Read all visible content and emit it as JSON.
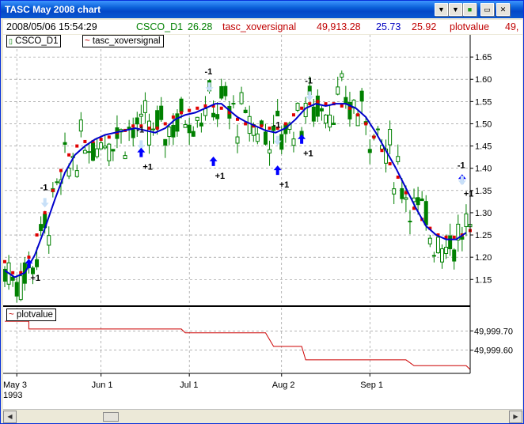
{
  "window": {
    "title": "TASC May 2008 chart"
  },
  "title_buttons": [
    "▼",
    "▼",
    "■",
    "▭",
    "✕"
  ],
  "info": {
    "datetime": "2008/05/06 15:54:29",
    "symbol": "CSCO_D1",
    "symbol_value": "26.28",
    "indicator": "tasc_xoversignal",
    "ind_v1": "49,913.28",
    "ind_v2": "25.73",
    "ind_v3": "25.92",
    "plot_name": "plotvalue",
    "plot_trunc": "49,"
  },
  "legend": {
    "symbol": "CSCO_D1",
    "indicator": "tasc_xoversignal",
    "sub": "plotvalue"
  },
  "colors": {
    "up": "#008000",
    "down": "#008000",
    "blue_line": "#0000cc",
    "red_dots": "#e00000",
    "sub_line": "#cc0000",
    "signal_arrow": "#0000ff",
    "signal_ghost": "#c8e0f8"
  },
  "x_axis": {
    "labels": [
      "May 3",
      "Jun 1",
      "Jul 1",
      "Aug 2",
      "Sep 1"
    ],
    "year": "1993"
  },
  "chart_data": [
    {
      "type": "candlestick",
      "series": [
        {
          "name": "CSCO_D1"
        },
        {
          "name": "tasc_xoversignal"
        }
      ],
      "ylim": [
        1.09,
        1.7
      ],
      "y_ticks": [
        "1.65",
        "1.60",
        "1.55",
        "1.50",
        "1.45",
        "1.40",
        "1.35",
        "1.30",
        "1.25",
        "1.20",
        "1.15"
      ],
      "y_tick_values": [
        1.65,
        1.6,
        1.55,
        1.5,
        1.45,
        1.4,
        1.35,
        1.3,
        1.25,
        1.2,
        1.15
      ],
      "grid": true,
      "blue_line": [
        [
          0,
          1.17
        ],
        [
          5,
          1.155
        ],
        [
          10,
          1.165
        ],
        [
          15,
          1.205
        ],
        [
          20,
          1.265
        ],
        [
          25,
          1.33
        ],
        [
          30,
          1.39
        ],
        [
          35,
          1.43
        ],
        [
          40,
          1.45
        ],
        [
          45,
          1.465
        ],
        [
          50,
          1.475
        ],
        [
          55,
          1.48
        ],
        [
          60,
          1.485
        ],
        [
          65,
          1.49
        ],
        [
          70,
          1.485
        ],
        [
          75,
          1.48
        ],
        [
          80,
          1.49
        ],
        [
          85,
          1.51
        ],
        [
          90,
          1.52
        ],
        [
          95,
          1.525
        ],
        [
          100,
          1.535
        ],
        [
          105,
          1.545
        ],
        [
          108,
          1.545
        ],
        [
          112,
          1.53
        ],
        [
          116,
          1.515
        ],
        [
          120,
          1.505
        ],
        [
          125,
          1.495
        ],
        [
          130,
          1.485
        ],
        [
          135,
          1.48
        ],
        [
          140,
          1.49
        ],
        [
          145,
          1.51
        ],
        [
          150,
          1.535
        ],
        [
          155,
          1.545
        ],
        [
          160,
          1.54
        ],
        [
          165,
          1.545
        ],
        [
          170,
          1.545
        ],
        [
          175,
          1.535
        ],
        [
          180,
          1.515
        ],
        [
          185,
          1.48
        ],
        [
          190,
          1.44
        ],
        [
          195,
          1.4
        ],
        [
          200,
          1.355
        ],
        [
          205,
          1.31
        ],
        [
          210,
          1.27
        ],
        [
          215,
          1.25
        ],
        [
          220,
          1.24
        ],
        [
          225,
          1.24
        ],
        [
          230,
          1.255
        ]
      ],
      "red_dots": [
        [
          0,
          1.19
        ],
        [
          4,
          1.165
        ],
        [
          8,
          1.165
        ],
        [
          12,
          1.2
        ],
        [
          16,
          1.25
        ],
        [
          20,
          1.3
        ],
        [
          24,
          1.35
        ],
        [
          28,
          1.395
        ],
        [
          32,
          1.43
        ],
        [
          36,
          1.45
        ],
        [
          40,
          1.46
        ],
        [
          44,
          1.46
        ],
        [
          48,
          1.465
        ],
        [
          52,
          1.47
        ],
        [
          56,
          1.48
        ],
        [
          60,
          1.485
        ],
        [
          64,
          1.495
        ],
        [
          68,
          1.495
        ],
        [
          72,
          1.49
        ],
        [
          76,
          1.49
        ],
        [
          80,
          1.5
        ],
        [
          84,
          1.515
        ],
        [
          88,
          1.525
        ],
        [
          92,
          1.53
        ],
        [
          96,
          1.535
        ],
        [
          100,
          1.54
        ],
        [
          104,
          1.54
        ],
        [
          108,
          1.535
        ],
        [
          112,
          1.525
        ],
        [
          116,
          1.51
        ],
        [
          120,
          1.5
        ],
        [
          124,
          1.495
        ],
        [
          128,
          1.495
        ],
        [
          132,
          1.49
        ],
        [
          136,
          1.49
        ],
        [
          140,
          1.5
        ],
        [
          144,
          1.52
        ],
        [
          148,
          1.535
        ],
        [
          152,
          1.545
        ],
        [
          156,
          1.55
        ],
        [
          160,
          1.545
        ],
        [
          164,
          1.545
        ],
        [
          168,
          1.54
        ],
        [
          172,
          1.535
        ],
        [
          176,
          1.52
        ],
        [
          180,
          1.5
        ],
        [
          184,
          1.47
        ],
        [
          188,
          1.44
        ],
        [
          192,
          1.41
        ],
        [
          196,
          1.38
        ],
        [
          200,
          1.345
        ],
        [
          204,
          1.31
        ],
        [
          208,
          1.285
        ],
        [
          212,
          1.265
        ],
        [
          216,
          1.25
        ],
        [
          220,
          1.245
        ],
        [
          224,
          1.245
        ],
        [
          228,
          1.25
        ],
        [
          232,
          1.26
        ]
      ],
      "signals": [
        [
          12,
          1.2,
          "up",
          "+1"
        ],
        [
          20,
          1.34,
          "down",
          "-1"
        ],
        [
          68,
          1.47,
          "down",
          "-1"
        ],
        [
          68,
          1.45,
          "up",
          "+1"
        ],
        [
          104,
          1.43,
          "up",
          "+1"
        ],
        [
          102,
          1.6,
          "down",
          "-1"
        ],
        [
          136,
          1.48,
          "down",
          "-1"
        ],
        [
          136,
          1.41,
          "up",
          "+1"
        ],
        [
          148,
          1.48,
          "up",
          "+1"
        ],
        [
          152,
          1.58,
          "down",
          "-1"
        ],
        [
          228,
          1.39,
          "up",
          "+1"
        ],
        [
          228,
          1.39,
          "down",
          "-1"
        ]
      ],
      "candles": []
    },
    {
      "type": "line",
      "series": [
        {
          "name": "plotvalue"
        }
      ],
      "ylim": [
        49999.48,
        49999.82
      ],
      "y_ticks": [
        "49,999.70",
        "49,999.60"
      ],
      "y_tick_values": [
        49999.7,
        49999.6
      ],
      "grid": true,
      "steps": [
        [
          0,
          49999.75
        ],
        [
          12,
          49999.75
        ],
        [
          12,
          49999.71
        ],
        [
          88,
          49999.71
        ],
        [
          90,
          49999.69
        ],
        [
          130,
          49999.69
        ],
        [
          134,
          49999.62
        ],
        [
          148,
          49999.62
        ],
        [
          150,
          49999.55
        ],
        [
          200,
          49999.55
        ],
        [
          204,
          49999.52
        ],
        [
          230,
          49999.52
        ],
        [
          232,
          49999.5
        ]
      ]
    }
  ]
}
